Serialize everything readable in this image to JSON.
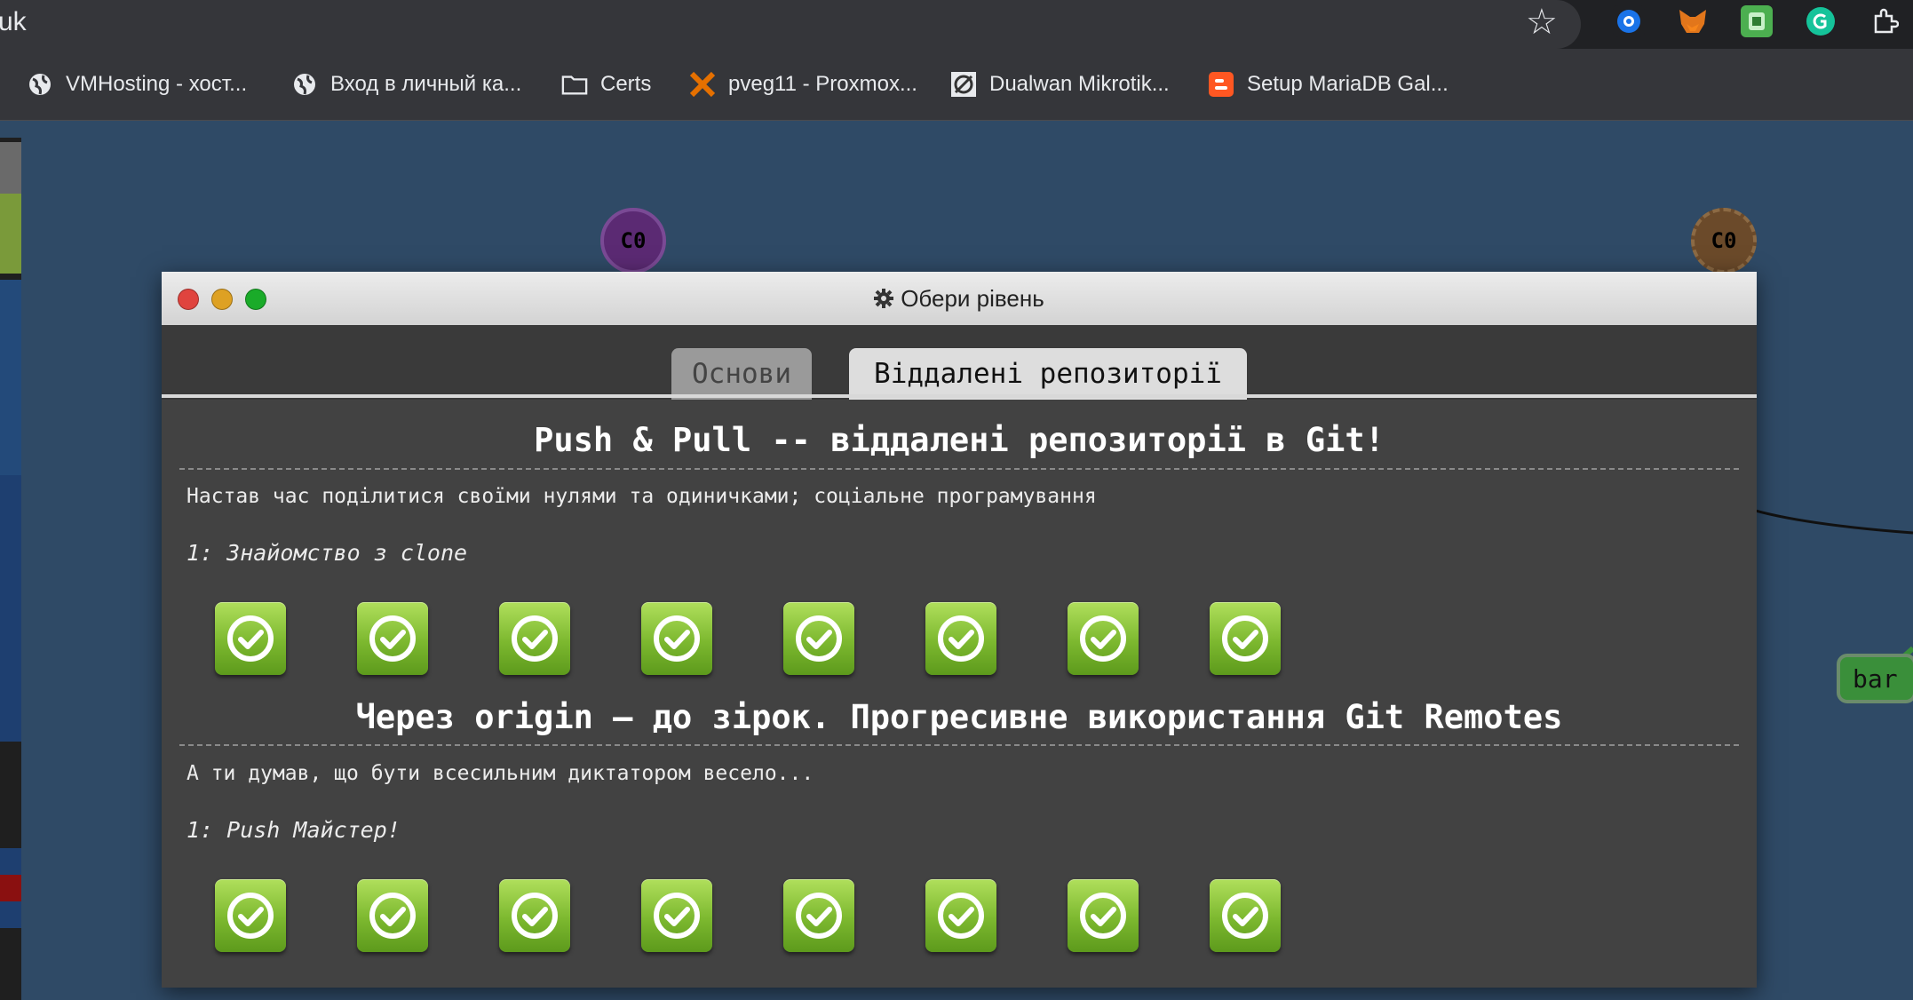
{
  "browser": {
    "url_fragment": "uk",
    "bookmarks": [
      {
        "label": "VMHosting - хост...",
        "icon": "globe-icon"
      },
      {
        "label": "Вход в личный ка...",
        "icon": "globe-icon"
      },
      {
        "label": "Certs",
        "icon": "folder-icon"
      },
      {
        "label": "pveg11 - Proxmox...",
        "icon": "proxmox-icon"
      },
      {
        "label": "Dualwan Mikrotik...",
        "icon": "mikrotik-icon"
      },
      {
        "label": "Setup MariaDB Gal...",
        "icon": "blogger-icon"
      }
    ],
    "extensions": [
      "eye-extension-icon",
      "metamask-fox-icon",
      "green-extension-icon",
      "grammarly-icon",
      "puzzle-extensions-icon"
    ]
  },
  "background": {
    "commits": [
      {
        "label": "C0",
        "color": "#5b2a73"
      },
      {
        "label": "C0",
        "color": "#6b4a2a"
      }
    ],
    "branch": "bar"
  },
  "dialog": {
    "title": "Обери рівень",
    "title_icon": "gear-icon",
    "tabs": [
      {
        "label": "Основи",
        "active": false
      },
      {
        "label": "Віддалені репозиторії",
        "active": true
      }
    ],
    "sections": [
      {
        "title": "Push & Pull -- віддалені репозиторії в Git!",
        "description": "Настав час поділитися своїми нулями та одиничками; соціальне програмування",
        "subtitle": "1: Знайомство з clone",
        "levels_completed": 8
      },
      {
        "title": "Через origin – до зірок. Прогресивне використання Git Remotes",
        "description": "А ти думав, що бути всесильним диктатором весело...",
        "subtitle": "1: Push Майстер!",
        "levels_completed": 8
      }
    ]
  },
  "colors": {
    "level_complete": "#7cb82f",
    "dialog_bg": "#424242",
    "page_bg": "#2f4a66"
  }
}
